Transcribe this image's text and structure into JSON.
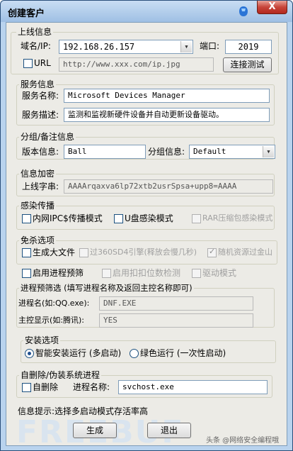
{
  "window": {
    "title": "创建客户",
    "close_label": "X"
  },
  "online": {
    "group_label": "上线信息",
    "domain_label": "域名/IP:",
    "domain_value": "192.168.26.157",
    "port_label": "端口:",
    "port_value": "2019",
    "url_label": "URL",
    "url_value": "http://www.xxx.com/ip.jpg",
    "test_button": "连接测试"
  },
  "service": {
    "group_label": "服务信息",
    "name_label": "服务名称:",
    "name_value": "Microsoft Devices Manager",
    "desc_label": "服务描述:",
    "desc_value": "监测和监视新硬件设备并自动更新设备驱动。"
  },
  "grouping": {
    "group_label": "分组/备注信息",
    "version_label": "版本信息:",
    "version_value": "Ball",
    "group_info_label": "分组信息:",
    "group_info_value": "Default"
  },
  "encrypt": {
    "group_label": "信息加密",
    "string_label": "上线字串:",
    "string_value": "AAAArqaxva6lp72xtb2usrSpsa+upp8=AAAA"
  },
  "infect": {
    "group_label": "感染传播",
    "lan_label": "内网IPC$传播模式",
    "usb_label": "U盘感染模式",
    "rar_label": "RAR压缩包感染模式"
  },
  "av": {
    "group_label": "免杀选项",
    "bigfile_label": "生成大文件",
    "bypass360_label": "过360SD4引擎(释放会慢几秒)",
    "random_label": "随机资源过金山"
  },
  "process": {
    "enable_label": "启用进程预筛",
    "hook_label": "启用扣扣位数检测",
    "driver_label": "驱动模式",
    "subgroup_label": "进程预筛选 (填写进程名称及返回主控名称即可)",
    "pname_label": "进程名(如:QQ.exe):",
    "pname_value": "DNF.EXE",
    "display_label": "主控显示(如:腾讯):",
    "display_value": "YES"
  },
  "install": {
    "group_label": "安装选项",
    "smart_label": "智能安装运行 (多启动)",
    "green_label": "绿色运行 (一次性启动)"
  },
  "selfdel": {
    "group_label": "自删除/伪装系统进程",
    "selfdel_label": "自删除",
    "process_label": "进程名称:",
    "process_value": "svchost.exe"
  },
  "footer": {
    "hint": "信息提示:选择多启动模式存活率高",
    "generate_button": "生成",
    "exit_button": "退出",
    "watermark": "FREEBUF",
    "credit": "头条 @网络安全编程哦"
  }
}
